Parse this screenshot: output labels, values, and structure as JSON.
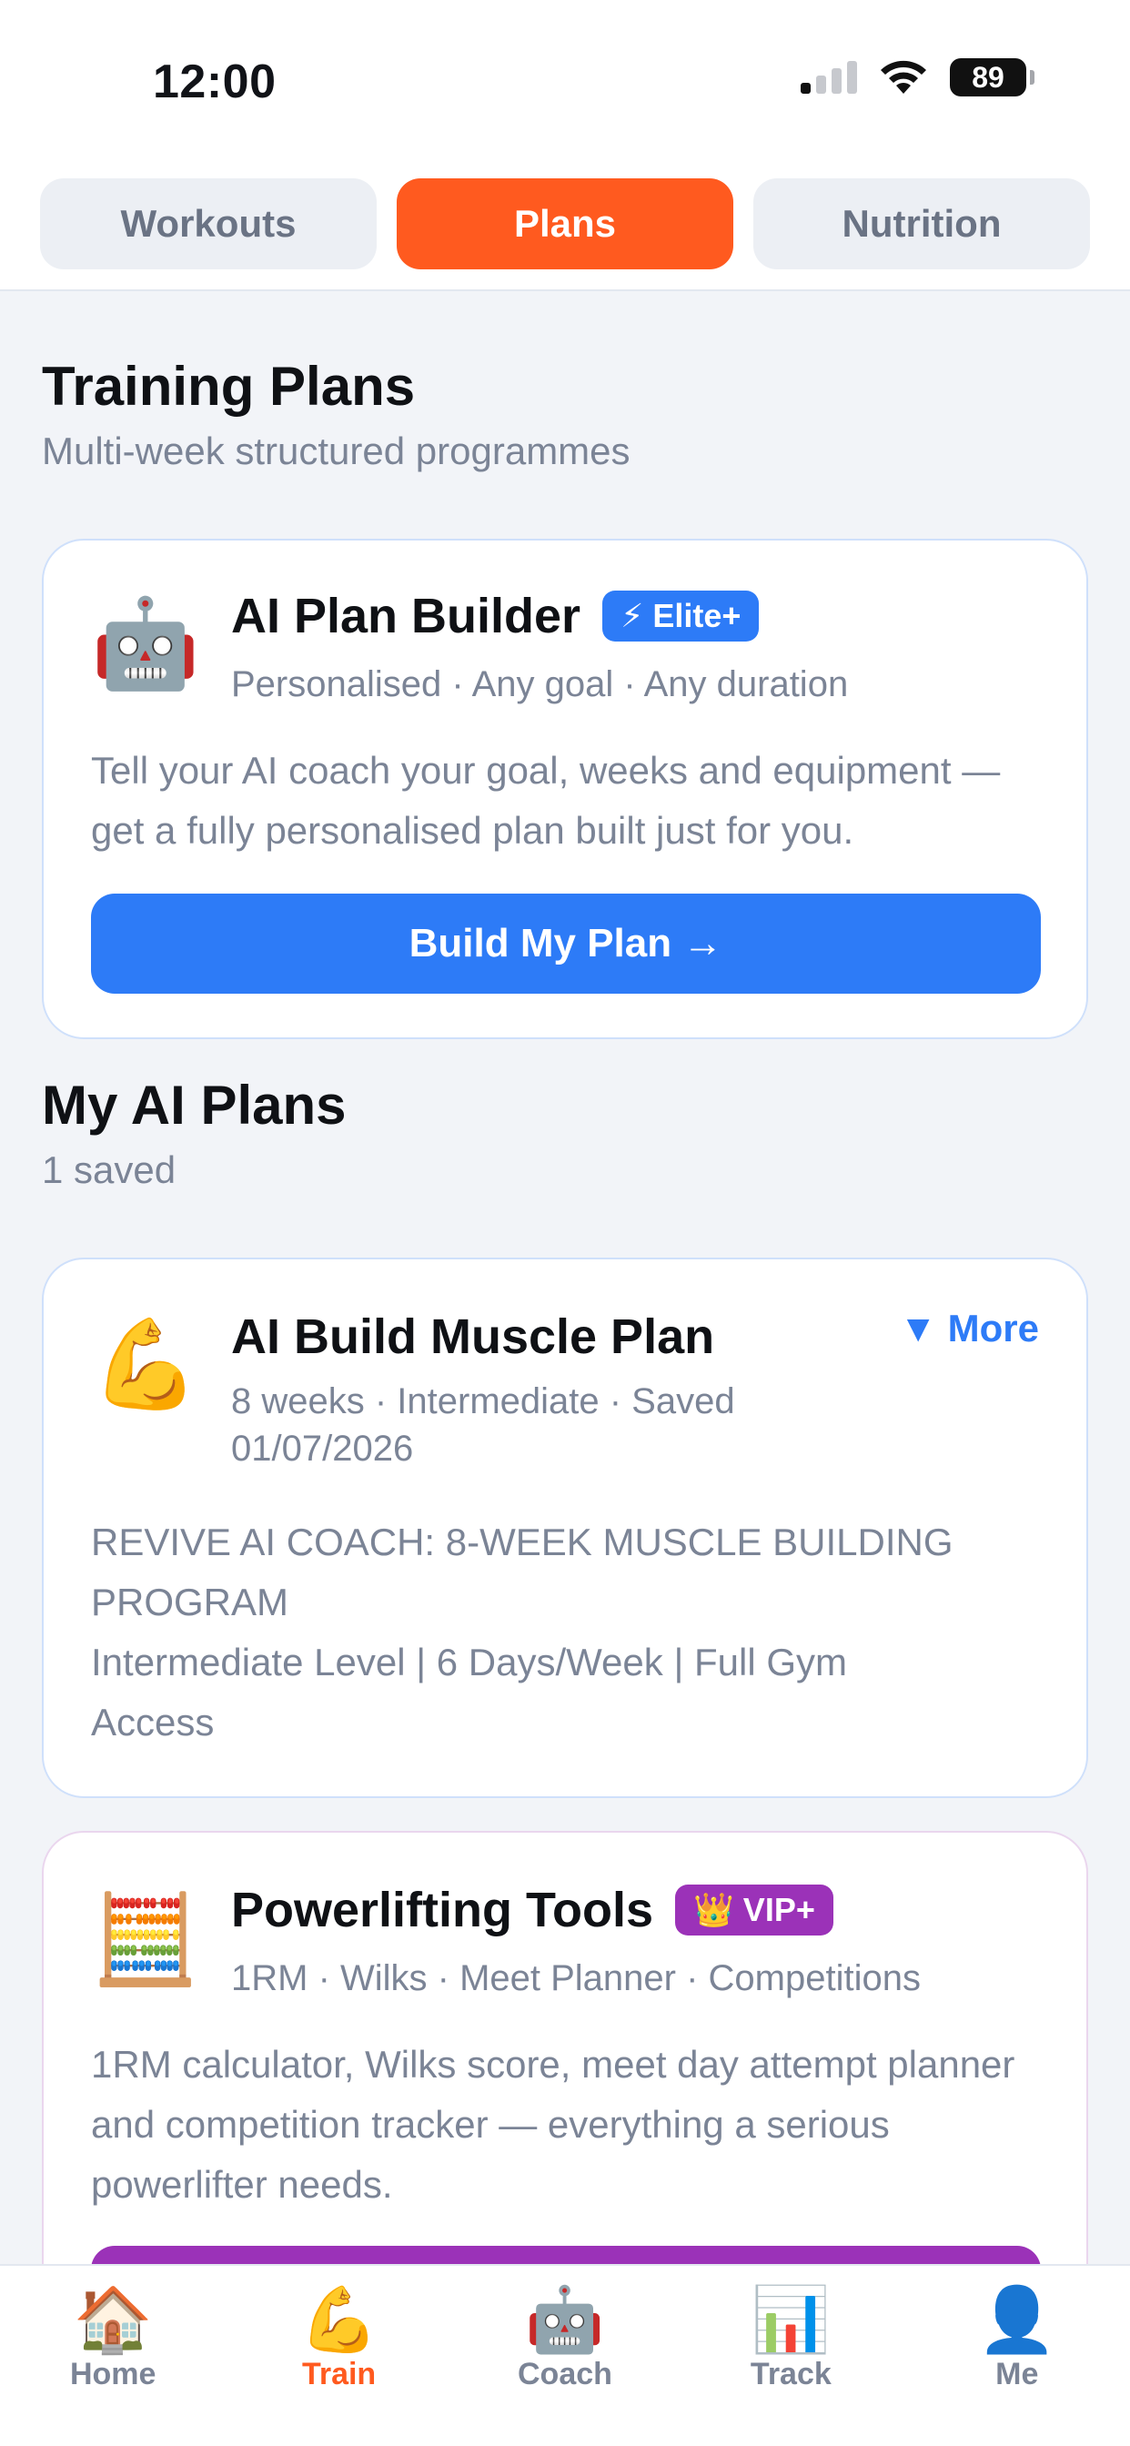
{
  "status_bar": {
    "time": "12:00",
    "battery": "89"
  },
  "top_tabs": [
    {
      "label": "Workouts",
      "active": false
    },
    {
      "label": "Plans",
      "active": true
    },
    {
      "label": "Nutrition",
      "active": false
    }
  ],
  "training_plans": {
    "title": "Training Plans",
    "subtitle": "Multi-week structured programmes"
  },
  "ai_builder_card": {
    "emoji": "🤖",
    "title": "AI Plan Builder",
    "badge": "⚡ Elite+",
    "meta": "Personalised · Any goal · Any duration",
    "description": "Tell your AI coach your goal, weeks and equipment — get a fully personalised plan built just for you.",
    "button_label": "Build My Plan →"
  },
  "my_ai_plans": {
    "title": "My AI Plans",
    "count_text": "1 saved"
  },
  "saved_plan_card": {
    "emoji": "💪",
    "title": "AI Build Muscle Plan",
    "more_label": "▼ More",
    "meta_line1": "8 weeks · Intermediate · Saved",
    "meta_line2": "01/07/2026",
    "desc_line1": "REVIVE AI COACH: 8-WEEK MUSCLE BUILDING",
    "desc_line2": "PROGRAM",
    "desc_line3": "Intermediate Level | 6 Days/Week | Full Gym",
    "desc_line4": "Access"
  },
  "powerlifting_card": {
    "emoji": "🧮",
    "title": "Powerlifting Tools",
    "badge": "👑 VIP+",
    "meta": "1RM · Wilks · Meet Planner · Competitions",
    "description": "1RM calculator, Wilks score, meet day attempt planner and competition tracker — everything a serious powerlifter needs."
  },
  "bottom_nav": [
    {
      "icon": "🏠",
      "icon_name": "home-icon",
      "label": "Home",
      "active": false
    },
    {
      "icon": "💪",
      "icon_name": "muscle-icon",
      "label": "Train",
      "active": true
    },
    {
      "icon": "🤖",
      "icon_name": "robot-icon",
      "label": "Coach",
      "active": false
    },
    {
      "icon": "📊",
      "icon_name": "chart-icon",
      "label": "Track",
      "active": false
    },
    {
      "icon": "👤",
      "icon_name": "user-icon",
      "label": "Me",
      "active": false
    }
  ],
  "colors": {
    "accent": "#ff5a1f",
    "primary": "#2d7bf7",
    "vip": "#9b32b8"
  }
}
